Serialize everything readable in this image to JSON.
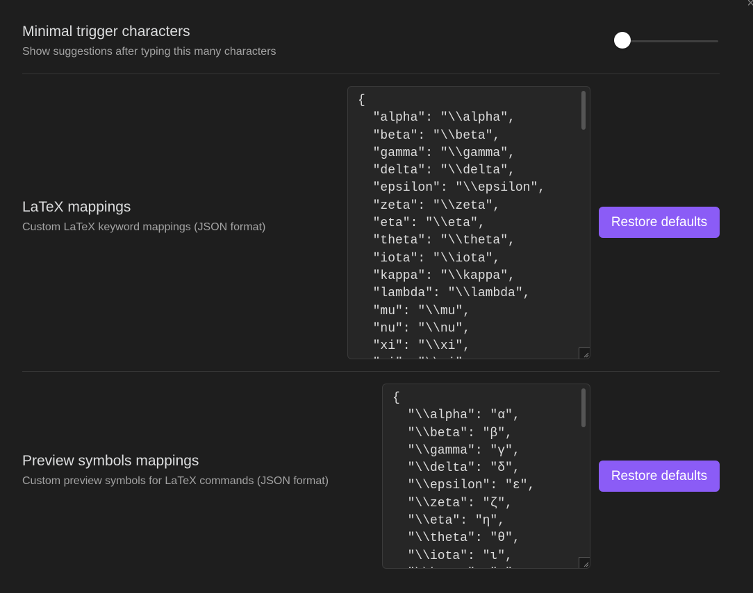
{
  "settings": {
    "min_trigger": {
      "name": "Minimal trigger characters",
      "description": "Show suggestions after typing this many characters",
      "slider_fraction": 0.0
    },
    "latex_mappings": {
      "name": "LaTeX mappings",
      "description": "Custom LaTeX keyword mappings (JSON format)",
      "value": "{\n  \"alpha\": \"\\\\alpha\",\n  \"beta\": \"\\\\beta\",\n  \"gamma\": \"\\\\gamma\",\n  \"delta\": \"\\\\delta\",\n  \"epsilon\": \"\\\\epsilon\",\n  \"zeta\": \"\\\\zeta\",\n  \"eta\": \"\\\\eta\",\n  \"theta\": \"\\\\theta\",\n  \"iota\": \"\\\\iota\",\n  \"kappa\": \"\\\\kappa\",\n  \"lambda\": \"\\\\lambda\",\n  \"mu\": \"\\\\mu\",\n  \"nu\": \"\\\\nu\",\n  \"xi\": \"\\\\xi\",\n  \"pi\": \"\\\\pi\",",
      "restore_label": "Restore defaults"
    },
    "preview_symbols": {
      "name": "Preview symbols mappings",
      "description": "Custom preview symbols for LaTeX commands (JSON format)",
      "value": "{\n  \"\\\\alpha\": \"α\",\n  \"\\\\beta\": \"β\",\n  \"\\\\gamma\": \"γ\",\n  \"\\\\delta\": \"δ\",\n  \"\\\\epsilon\": \"ε\",\n  \"\\\\zeta\": \"ζ\",\n  \"\\\\eta\": \"η\",\n  \"\\\\theta\": \"θ\",\n  \"\\\\iota\": \"ι\",\n  \"\\\\kappa\": \"κ\",",
      "restore_label": "Restore defaults"
    }
  },
  "colors": {
    "accent": "#8b5cf6",
    "background": "#1e1e1e"
  }
}
